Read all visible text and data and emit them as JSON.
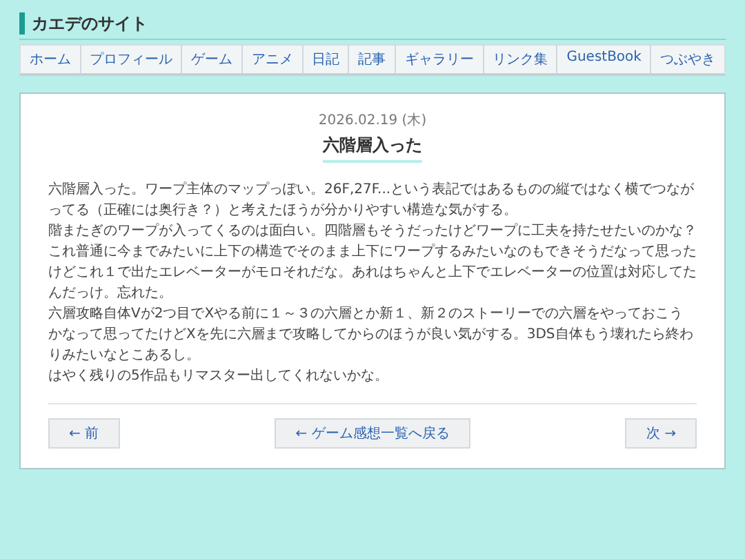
{
  "site": {
    "title": "カエデのサイト"
  },
  "nav": [
    {
      "label": "ホーム"
    },
    {
      "label": "プロフィール"
    },
    {
      "label": "ゲーム"
    },
    {
      "label": "アニメ"
    },
    {
      "label": "日記"
    },
    {
      "label": "記事"
    },
    {
      "label": "ギャラリー"
    },
    {
      "label": "リンク集"
    },
    {
      "label": "GuestBook"
    },
    {
      "label": "つぶやき"
    }
  ],
  "article": {
    "date": "2026.02.19 (木)",
    "title": "六階層入った",
    "paragraphs": [
      "六階層入った。ワープ主体のマップっぽい。26F,27F...という表記ではあるものの縦ではなく横でつながってる（正確には奥行き？）と考えたほうが分かりやすい構造な気がする。",
      "階またぎのワープが入ってくるのは面白い。四階層もそうだったけどワープに工夫を持たせたいのかな？",
      "これ普通に今までみたいに上下の構造でそのまま上下にワープするみたいなのもできそうだなって思ったけどこれ１で出たエレベーターがモロそれだな。あれはちゃんと上下でエレベーターの位置は対応してたんだっけ。忘れた。",
      "六層攻略自体Vが2つ目でXやる前に１～３の六層とか新１、新２のストーリーでの六層をやっておこうかなって思ってたけどXを先に六層まで攻略してからのほうが良い気がする。3DS自体もう壊れたら終わりみたいなとこあるし。",
      "はやく残りの5作品もリマスター出してくれないかな。"
    ]
  },
  "pager": {
    "prev": "← 前",
    "list": "← ゲーム感想一覧へ戻る",
    "next": "次 →"
  }
}
